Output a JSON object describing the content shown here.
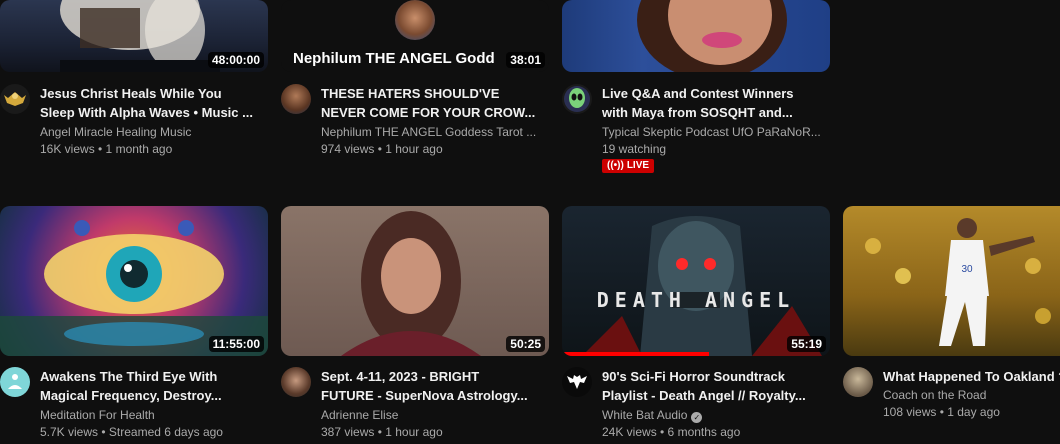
{
  "row1": [
    {
      "title_line1": "Jesus Christ Heals While You",
      "title_line2": "Sleep With Alpha Waves • Music ...",
      "channel": "Angel Miracle Healing Music",
      "stats": "16K views • 1 month ago",
      "duration": "48:00:00"
    },
    {
      "title_line1": "THESE HATERS SHOULD'VE",
      "title_line2": "NEVER COME FOR YOUR CROW...",
      "channel": "Nephilum THE ANGEL Goddess Tarot ...",
      "stats": "974 views • 1 hour ago",
      "duration": "38:01",
      "overlay_title": "Nephilum THE ANGEL Godd"
    },
    {
      "title_line1": "Live Q&A and Contest Winners",
      "title_line2": "with Maya from SOSQHT and...",
      "channel": "Typical Skeptic Podcast UfO PaRaNoR...",
      "stats": "19 watching",
      "live_label": "LIVE"
    }
  ],
  "row2": [
    {
      "title_line1": "Awakens The Third Eye With",
      "title_line2": "Magical Frequency, Destroy...",
      "channel": "Meditation For Health",
      "stats": "5.7K views • Streamed 6 days ago",
      "duration": "11:55:00"
    },
    {
      "title_line1": "Sept. 4-11, 2023 - BRIGHT",
      "title_line2": "FUTURE - SuperNova Astrology...",
      "channel": "Adrienne Elise",
      "stats": "387 views • 1 hour ago",
      "duration": "50:25"
    },
    {
      "title_line1": "90's Sci-Fi Horror Soundtrack",
      "title_line2": "Playlist - Death Angel // Royalty...",
      "channel": "White Bat Audio",
      "stats": "24K views • 6 months ago",
      "duration": "55:19",
      "thumb_text": "DEATH ANGEL",
      "watched_fraction": 0.55
    },
    {
      "title_line1": "What Happened To Oakland ?",
      "channel": "Coach on the Road",
      "stats": "108 views • 1 day ago"
    }
  ]
}
